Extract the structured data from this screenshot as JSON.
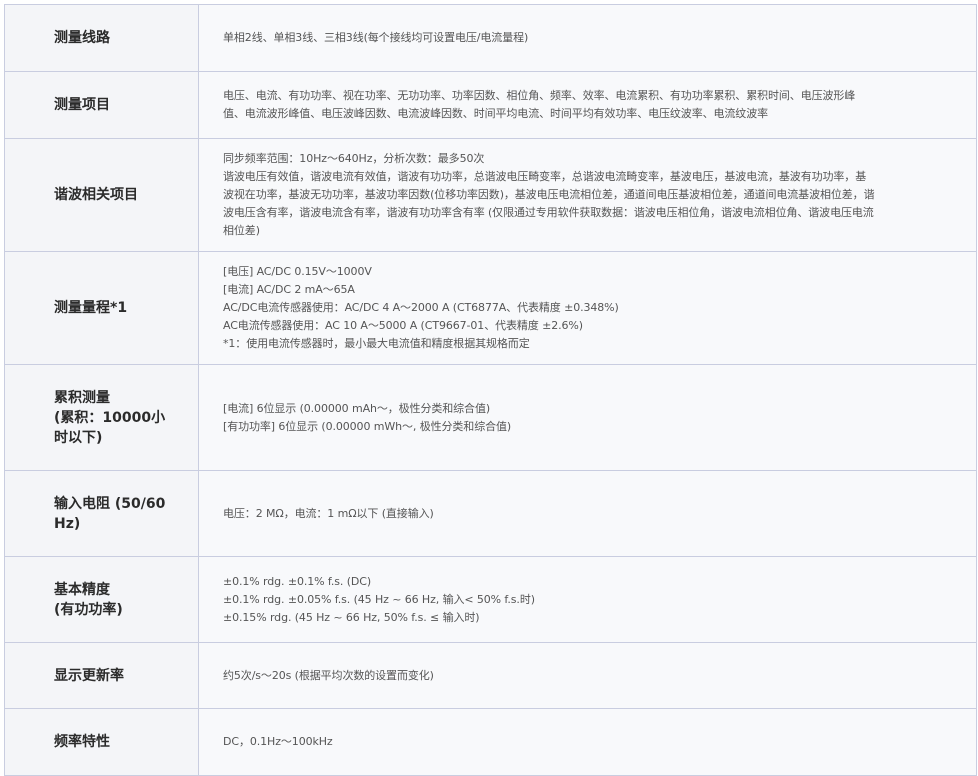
{
  "rows": [
    {
      "label": "测量线路",
      "lines": [
        "单相2线、单相3线、三相3线(每个接线均可设置电压/电流量程)"
      ]
    },
    {
      "label": "测量项目",
      "lines": [
        "电压、电流、有功功率、视在功率、无功功率、功率因数、相位角、频率、效率、电流累积、有功功率累积、累积时间、电压波形峰",
        "值、电流波形峰值、电压波峰因数、电流波峰因数、时间平均电流、时间平均有效功率、电压纹波率、电流纹波率"
      ]
    },
    {
      "label": "谐波相关项目",
      "lines": [
        "同步频率范围：10Hz～640Hz，分析次数：最多50次",
        "谐波电压有效值，谐波电流有效值，谐波有功功率，总谐波电压畸变率，总谐波电流畸变率，基波电压，基波电流，基波有功功率，基",
        "波视在功率，基波无功功率，基波功率因数(位移功率因数)，基波电压电流相位差，通道间电压基波相位差，通道间电流基波相位差，谐",
        "波电压含有率，谐波电流含有率，谐波有功功率含有率 (仅限通过专用软件获取数据：谐波电压相位角，谐波电流相位角、谐波电压电流",
        "相位差)"
      ]
    },
    {
      "label": "测量量程*1",
      "lines": [
        "[电压] AC/DC 0.15V～1000V",
        "[电流] AC/DC 2 mA～65A",
        "AC/DC电流传感器使用：AC/DC 4 A～2000 A (CT6877A、代表精度 ±0.348%)",
        "AC电流传感器使用：AC 10 A～5000 A (CT9667-01、代表精度 ±2.6%)",
        "*1：使用电流传感器时，最小最大电流值和精度根据其规格而定"
      ]
    },
    {
      "label": "累积测量\n(累积：10000小\n时以下)",
      "lines": [
        "[电流] 6位显示 (0.00000 mAh～，极性分类和综合值)",
        "[有功功率] 6位显示 (0.00000 mWh～, 极性分类和综合值)"
      ]
    },
    {
      "label": "输入电阻 (50/60\nHz)",
      "lines": [
        "电压：2 MΩ，电流：1 mΩ以下 (直接输入)"
      ]
    },
    {
      "label": "基本精度\n(有功功率)",
      "lines": [
        "±0.1% rdg. ±0.1% f.s. (DC)",
        "±0.1% rdg. ±0.05% f.s. (45 Hz ~ 66 Hz, 输入< 50% f.s.时)",
        "±0.15% rdg. (45 Hz ~ 66 Hz, 50% f.s. ≤ 输入时)"
      ]
    },
    {
      "label": "显示更新率",
      "lines": [
        "约5次/s～20s (根据平均次数的设置而变化)"
      ]
    },
    {
      "label": "频率特性",
      "lines": [
        "DC，0.1Hz～100kHz"
      ]
    }
  ]
}
